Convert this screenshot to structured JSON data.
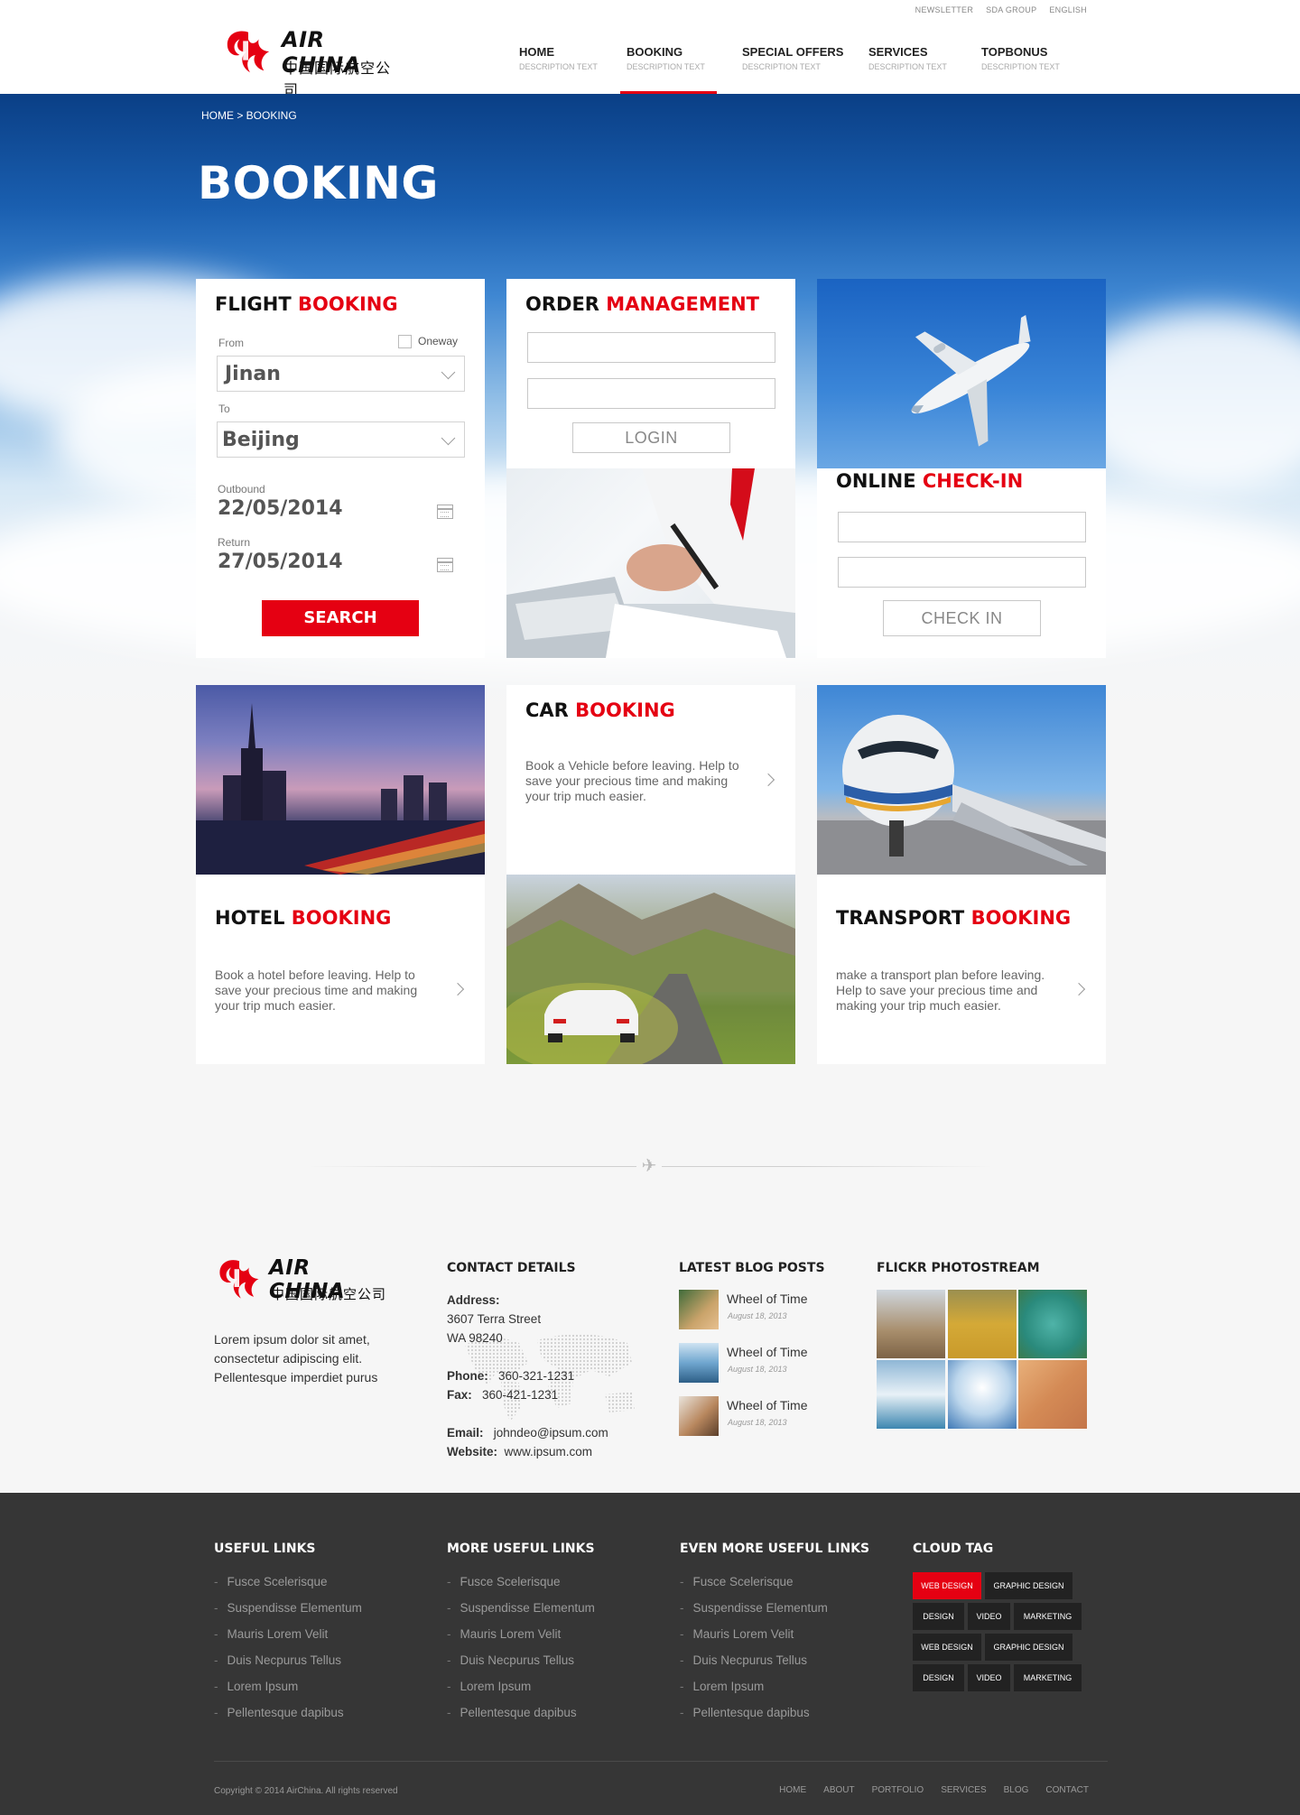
{
  "toplinks": [
    "NEWSLETTER",
    "SDA GROUP",
    "ENGLISH"
  ],
  "logo": {
    "name": "AIR CHINA",
    "chinese": "中国国际航空公司"
  },
  "nav": [
    {
      "label": "HOME",
      "desc": "DESCRIPTION TEXT"
    },
    {
      "label": "BOOKING",
      "desc": "DESCRIPTION TEXT"
    },
    {
      "label": "SPECIAL OFFERS",
      "desc": "DESCRIPTION TEXT"
    },
    {
      "label": "SERVICES",
      "desc": "DESCRIPTION TEXT"
    },
    {
      "label": "TOPBONUS",
      "desc": "DESCRIPTION TEXT"
    }
  ],
  "breadcrumb": "HOME > BOOKING",
  "page_title": "BOOKING",
  "flight": {
    "title_a": "FLIGHT",
    "title_b": "BOOKING",
    "from_label": "From",
    "from_value": "Jinan",
    "oneway_label": "Oneway",
    "to_label": "To",
    "to_value": "Beijing",
    "outbound_label": "Outbound",
    "outbound_value": "22/05/2014",
    "return_label": "Return",
    "return_value": "27/05/2014",
    "search_label": "SEARCH"
  },
  "order": {
    "title_a": "ORDER",
    "title_b": "MANAGEMENT",
    "login_label": "LOGIN"
  },
  "checkin": {
    "title_a": "ONLINE",
    "title_b": "CHECK-IN",
    "button_label": "CHECK IN"
  },
  "car": {
    "title_a": "CAR",
    "title_b": "BOOKING",
    "text": "Book a Vehicle before leaving. Help to save your precious time and making your trip much easier."
  },
  "hotel": {
    "title_a": "HOTEL",
    "title_b": "BOOKING",
    "text": "Book a hotel before leaving. Help to save your precious time and making your trip much easier."
  },
  "transport": {
    "title_a": "TRANSPORT",
    "title_b": "BOOKING",
    "text": "make a transport plan before leaving. Help to save your precious time and making your trip much easier."
  },
  "footer": {
    "about": "Lorem ipsum dolor sit amet, consectetur adipiscing elit. Pellentesque imperdiet purus",
    "contact_head": "CONTACT DETAILS",
    "address_label": "Address:",
    "address_line1": "3607 Terra Street",
    "address_line2": "WA 98240",
    "phone_label": "Phone:",
    "phone": "360-321-1231",
    "fax_label": "Fax:",
    "fax": "360-421-1231",
    "email_label": "Email:",
    "email": "johndeo@ipsum.com",
    "website_label": "Website:",
    "website": "www.ipsum.com",
    "blog_head": "LATEST BLOG POSTS",
    "blog": [
      {
        "title": "Wheel of Time",
        "date": "August 18, 2013"
      },
      {
        "title": "Wheel of Time",
        "date": "August 18, 2013"
      },
      {
        "title": "Wheel of Time",
        "date": "August 18, 2013"
      }
    ],
    "flickr_head": "FLICKR PHOTOSTREAM"
  },
  "dark": {
    "col1_head": "USEFUL LINKS",
    "col2_head": "MORE USEFUL LINKS",
    "col3_head": "EVEN MORE USEFUL LINKS",
    "links": [
      "Fusce Scelerisque",
      "Suspendisse Elementum",
      "Mauris Lorem Velit",
      "Duis Necpurus Tellus",
      "Lorem Ipsum",
      "Pellentesque dapibus"
    ],
    "cloud_head": "CLOUD TAG",
    "tags": [
      "WEB DESIGN",
      "GRAPHIC DESIGN",
      "DESIGN",
      "VIDEO",
      "MARKETING",
      "WEB DESIGN",
      "GRAPHIC DESIGN",
      "DESIGN",
      "VIDEO",
      "MARKETING"
    ],
    "copyright": "Copyright © 2014 AirChina. All rights reserved",
    "bottom_nav": [
      "HOME",
      "ABOUT",
      "PORTFOLIO",
      "SERVICES",
      "BLOG",
      "CONTACT"
    ]
  },
  "colors": {
    "accent": "#e50012",
    "dark_footer": "#363636",
    "hero_top": "#0a3f86"
  }
}
